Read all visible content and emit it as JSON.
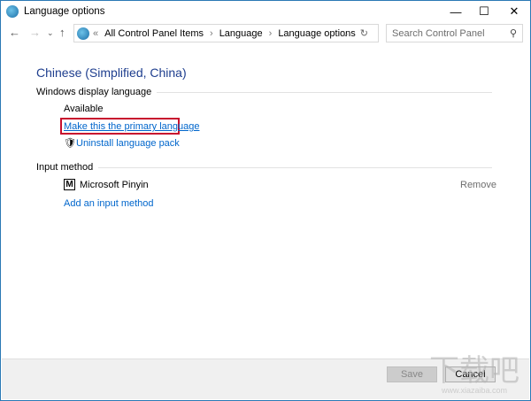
{
  "window": {
    "title": "Language options"
  },
  "address": {
    "overflow": "«",
    "crumbs": [
      "All Control Panel Items",
      "Language",
      "Language options"
    ]
  },
  "search": {
    "placeholder": "Search Control Panel"
  },
  "main": {
    "heading": "Chinese (Simplified, China)",
    "display_section": "Windows display language",
    "status": "Available",
    "primary_link": "Make this the primary language",
    "uninstall_link": "Uninstall language pack",
    "input_section": "Input method",
    "input_name": "Microsoft Pinyin",
    "input_icon_letter": "M",
    "remove": "Remove",
    "add_input": "Add an input method"
  },
  "footer": {
    "save": "Save",
    "cancel": "Cancel"
  },
  "watermark": {
    "logo": "下载吧",
    "url": "www.xiazaiba.com"
  }
}
